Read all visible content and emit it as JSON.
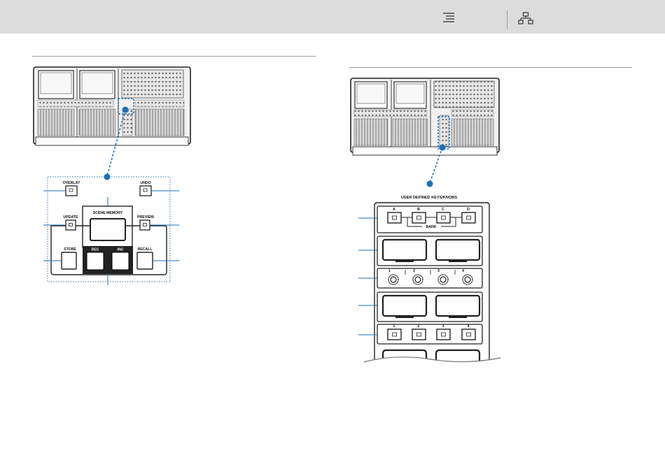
{
  "toolbar": {
    "icons": [
      "contents-list-icon",
      "site-map-icon"
    ]
  },
  "scene_memory_panel": {
    "title": "SCENE  MEMORY",
    "keys": {
      "overlay": "OVERLAY",
      "undo": "UNDO",
      "update": "UPDATE",
      "preview": "PREVIEW",
      "store": "STORE",
      "dec": "DEC",
      "inc": "INC",
      "recall": "RECALL"
    }
  },
  "user_defined_panel": {
    "title": "USER DEFINED  KEYS/KNOBS",
    "bank_keys": [
      "A",
      "B",
      "C",
      "D"
    ],
    "bank_label": "BANK",
    "knob_numbers": [
      "1",
      "2",
      "3",
      "4"
    ],
    "key_numbers": [
      "1",
      "2",
      "3",
      "4"
    ]
  },
  "colors": {
    "callout": "#1f6fb5",
    "toolbar_bg": "#dcdcdc",
    "rule": "#9a9a9a",
    "panel_edge": "#222222"
  }
}
